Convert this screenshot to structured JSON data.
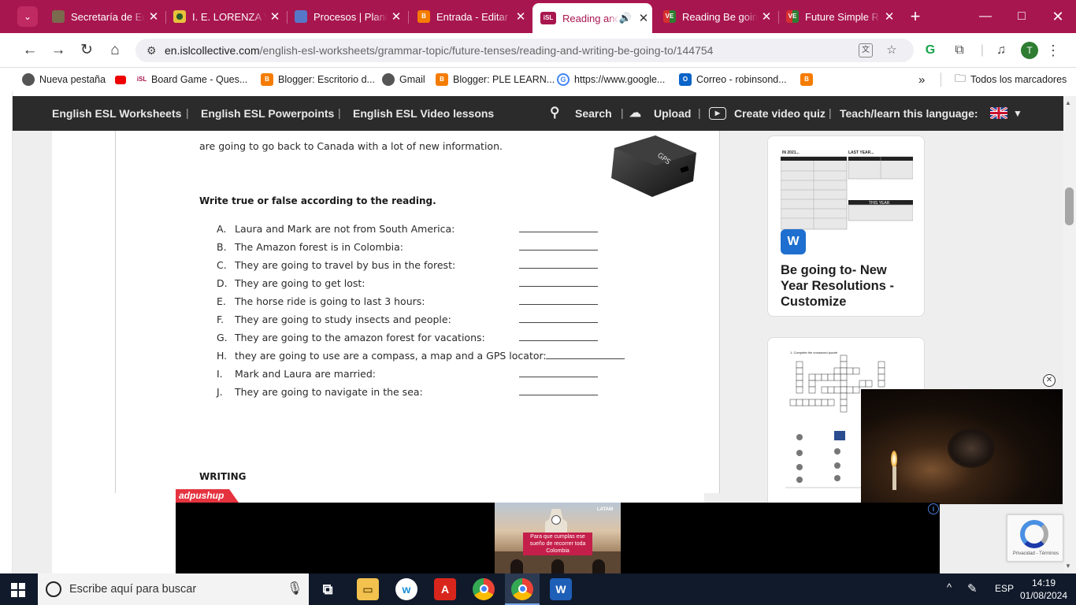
{
  "browser": {
    "tabs": [
      {
        "title": "Secretaría de Ed",
        "favicon": "crest-icon",
        "active": false
      },
      {
        "title": "I. E. LORENZA V",
        "favicon": "flag-icon",
        "active": false
      },
      {
        "title": "Procesos | Planil",
        "favicon": "process-icon",
        "active": false
      },
      {
        "title": "Entrada - Editar",
        "favicon": "blogger-icon",
        "active": false
      },
      {
        "title": "Reading and",
        "favicon": "isl-icon",
        "active": true,
        "audio": true
      },
      {
        "title": "Reading Be goin",
        "favicon": "ve-icon",
        "active": false
      },
      {
        "title": "Future Simple R",
        "favicon": "ve-icon",
        "active": false
      }
    ],
    "url_domain": "en.islcollective.com",
    "url_path": "/english-esl-worksheets/grammar-topic/future-tenses/reading-and-writing-be-going-to/144754",
    "profile_initial": "T",
    "bookmarks": [
      {
        "label": "Nueva pestaña"
      },
      {
        "label": "Board Game - Ques..."
      },
      {
        "label": "Blogger: Escritorio d..."
      },
      {
        "label": "Gmail"
      },
      {
        "label": "Blogger: PLE LEARN..."
      },
      {
        "label": "https://www.google..."
      },
      {
        "label": "Correo - robinsond..."
      }
    ],
    "all_bookmarks": "Todos los marcadores",
    "overflow": "»"
  },
  "site_nav": {
    "items": [
      "English ESL Worksheets",
      "English ESL Powerpoints",
      "English ESL Video lessons"
    ],
    "search": "Search",
    "upload": "Upload",
    "create_quiz": "Create video quiz",
    "teach": "Teach/learn this language:"
  },
  "worksheet": {
    "intro_line": "are going to go back to Canada with a lot of new information.",
    "gps_label": "GPS",
    "instruction": "Write true or false according to the reading.",
    "questions": [
      {
        "letter": "A.",
        "text": "Laura and Mark are not from South America:"
      },
      {
        "letter": "B.",
        "text": "The Amazon forest is in Colombia:"
      },
      {
        "letter": "C.",
        "text": "They are going to travel by bus in the forest:"
      },
      {
        "letter": "D.",
        "text": "They are going to get lost:"
      },
      {
        "letter": "E.",
        "text": "The horse ride is going to last 3 hours:"
      },
      {
        "letter": "F.",
        "text": "They are going to study insects and people:"
      },
      {
        "letter": "G.",
        "text": "They are going to the amazon forest for vacations:"
      },
      {
        "letter": "H.",
        "text": "they are going to use are a compass, a map and a GPS locator:"
      },
      {
        "letter": "I.",
        "text": "Mark and Laura are married:"
      },
      {
        "letter": "J.",
        "text": "They are going to navigate in the sea:"
      }
    ],
    "writing_heading": "WRITING"
  },
  "sidebar": {
    "card1": {
      "thumb_left": "IN 2021...",
      "thumb_right": "LAST YEAR...",
      "thumb_sub": "THIS YEAR",
      "title": "Be going to- New Year Resolutions - Customize"
    },
    "card2": {
      "thumb_heading": "1. Complete the crossword puzzle"
    }
  },
  "ads": {
    "network_label": "adpushup",
    "banner_text": "Para que cumplas ese sueño de recorrer toda Colombia",
    "banner_brand": "LATAM",
    "recaptcha_terms": "Privacidad - Términos"
  },
  "taskbar": {
    "search_placeholder": "Escribe aquí para buscar",
    "language": "ESP",
    "time": "14:19",
    "date": "01/08/2024"
  },
  "colors": {
    "chrome_accent": "#a8164f",
    "site_nav": "#2b2b2b",
    "taskbar": "#101a2b"
  }
}
